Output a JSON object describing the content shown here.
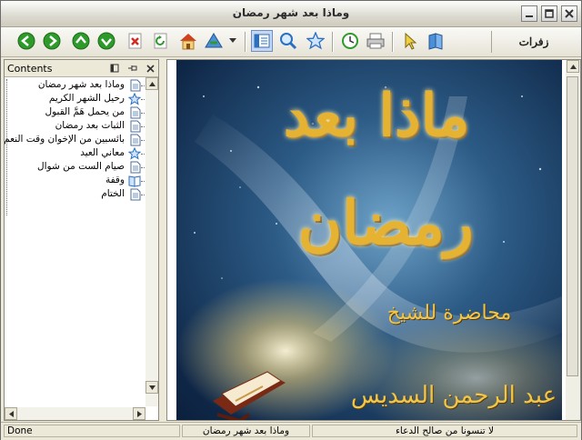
{
  "window": {
    "title": "وماذا بعد شهر رمضان"
  },
  "toolbar": {
    "buttons": [
      {
        "name": "back-icon",
        "color": "#2e9a2a"
      },
      {
        "name": "forward-icon",
        "color": "#2e9a2a"
      },
      {
        "name": "up-icon",
        "color": "#2e9a2a"
      },
      {
        "name": "down-icon",
        "color": "#2e9a2a"
      },
      {
        "name": "stop-icon",
        "color": "#d42b20"
      },
      {
        "name": "refresh-icon",
        "color": "#2e9a2a"
      },
      {
        "name": "home-icon",
        "color": "#e7a128"
      },
      {
        "name": "sync-icon",
        "color": "#2a6fc0"
      },
      {
        "name": "contents-pane-icon",
        "color": "#2a6fc0"
      },
      {
        "name": "search-icon",
        "color": "#2a6fc0"
      },
      {
        "name": "favorites-icon",
        "color": "#2a6fc0"
      },
      {
        "name": "history-icon",
        "color": "#2e9a2a"
      },
      {
        "name": "print-icon",
        "color": "#666666"
      },
      {
        "name": "pointer-icon",
        "color": "#e7c028"
      },
      {
        "name": "book-icon",
        "color": "#2a6fc0"
      }
    ],
    "logo_text": "زفرات"
  },
  "sidebar": {
    "title": "Contents",
    "items": [
      {
        "label": "وماذا بعد شهر رمضان",
        "icon": "page-icon"
      },
      {
        "label": "رحيل الشهر الكريم",
        "icon": "star-icon"
      },
      {
        "label": "من يحمل هَمَّ القبول",
        "icon": "page-icon"
      },
      {
        "label": "الثبات بعد رمضان",
        "icon": "page-icon"
      },
      {
        "label": "بائسبين من الإخوان وقت النعم",
        "icon": "page-icon"
      },
      {
        "label": "معاني العيد",
        "icon": "star-icon"
      },
      {
        "label": "صيام الست من شوال",
        "icon": "page-icon"
      },
      {
        "label": "وقفة",
        "icon": "book-icon"
      },
      {
        "label": "الختام",
        "icon": "page-icon"
      }
    ]
  },
  "content": {
    "headline_line1": "ماذا بعد",
    "headline_line2": "رمضان",
    "lecture_label": "محاضرة للشيخ",
    "author_name": "عبد الرحمن السديس"
  },
  "status": {
    "left": "Done",
    "middle": "وماذا بعد شهر رمضان",
    "right": "لا تنسونا من صالح الدعاء"
  },
  "colors": {
    "accent_gold": "#e6b232",
    "night_blue": "#122a4a"
  }
}
